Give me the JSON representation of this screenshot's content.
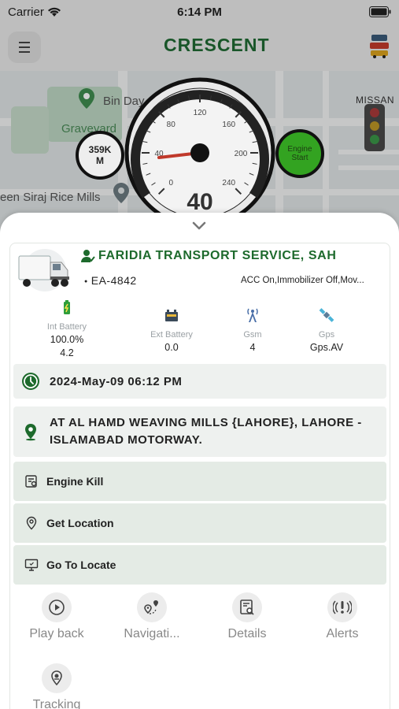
{
  "status_bar": {
    "carrier": "Carrier",
    "time": "6:14 PM"
  },
  "header": {
    "logo_text": "CRESCENT"
  },
  "map": {
    "labels": [
      "Bin Day",
      "Graveyard",
      "een Siraj Rice Mills",
      "MISSAN"
    ]
  },
  "dashboard": {
    "odometer": {
      "value": "359K",
      "unit": "M"
    },
    "speed": "40",
    "speed_ticks": [
      "0",
      "40",
      "80",
      "120",
      "160",
      "200",
      "240"
    ],
    "engine_button": {
      "line1": "Engine",
      "line2": "Start"
    }
  },
  "vehicle": {
    "company": "FARIDIA TRANSPORT SERVICE, SAH",
    "plate": "EA-4842",
    "status": "ACC On,Immobilizer Off,Mov..."
  },
  "metrics": [
    {
      "label": "Int Battery",
      "value": "100.0%",
      "value2": "4.2",
      "icon": "battery-icon"
    },
    {
      "label": "Ext Battery",
      "value": "0.0",
      "icon": "car-battery-icon"
    },
    {
      "label": "Gsm",
      "value": "4",
      "icon": "tower-icon"
    },
    {
      "label": "Gps",
      "value": "Gps.AV",
      "icon": "satellite-icon"
    }
  ],
  "info": {
    "datetime": "2024-May-09 06:12 PM",
    "location": "AT AL HAMD WEAVING MILLS {LAHORE}, LAHORE - ISLAMABAD MOTORWAY."
  },
  "commands": [
    {
      "label": "Engine Kill",
      "icon": "engine-kill-icon"
    },
    {
      "label": "Get Location",
      "icon": "location-pin-icon"
    },
    {
      "label": "Go To Locate",
      "icon": "monitor-icon"
    }
  ],
  "bottom_actions": [
    {
      "label": "Play back",
      "icon": "play-icon"
    },
    {
      "label": "Navigati...",
      "icon": "route-icon"
    },
    {
      "label": "Details",
      "icon": "details-icon"
    },
    {
      "label": "Alerts",
      "icon": "alert-icon"
    },
    {
      "label": "Tracking",
      "icon": "tracking-icon"
    }
  ],
  "colors": {
    "brand_green": "#1d6a2c",
    "engine_green": "#33a321",
    "row_bg": "#eef1ef"
  }
}
